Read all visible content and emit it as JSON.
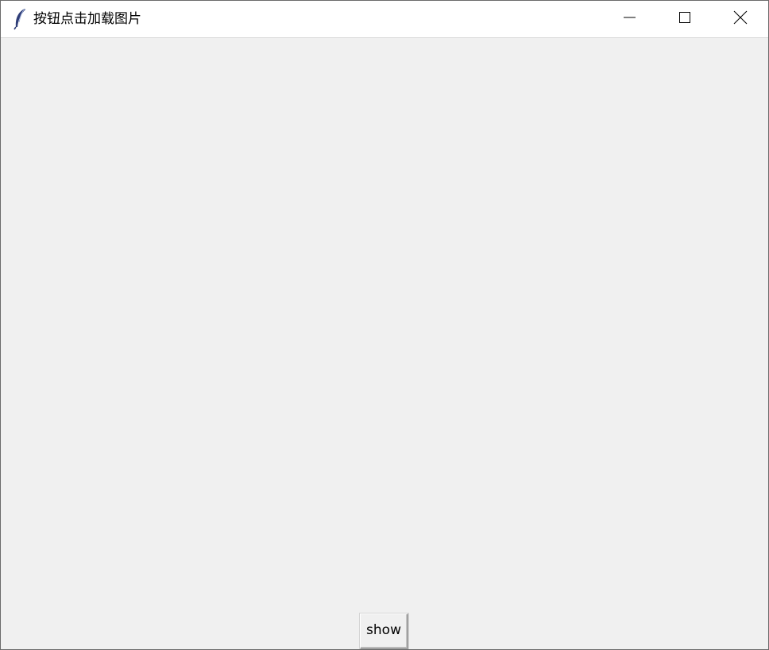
{
  "window": {
    "title": "按钮点击加载图片",
    "app_icon": "tk-feather-icon",
    "controls": [
      "minimize-icon",
      "maximize-icon",
      "close-icon"
    ]
  },
  "main": {
    "show_button_label": "show"
  },
  "colors": {
    "titlebar_bg": "#ffffff",
    "client_bg": "#f0f0f0",
    "button_bg": "#f0f0f0",
    "text": "#000000"
  }
}
